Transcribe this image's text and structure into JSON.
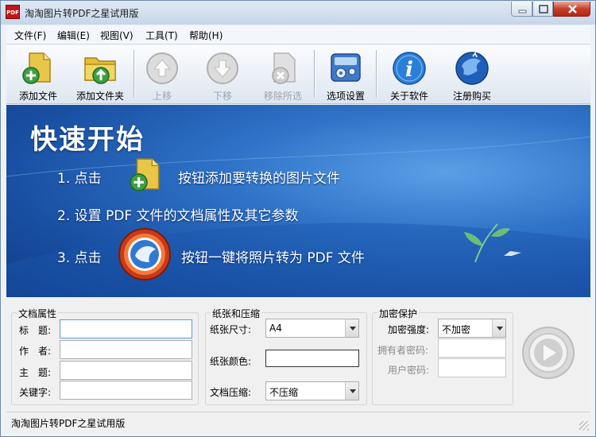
{
  "window": {
    "title": "淘淘图片转PDF之星试用版",
    "icon_text": "PDF"
  },
  "menu": [
    {
      "label": "文件(F)"
    },
    {
      "label": "编辑(E)"
    },
    {
      "label": "视图(V)"
    },
    {
      "label": "工具(T)"
    },
    {
      "label": "帮助(H)"
    }
  ],
  "toolbar": {
    "add_file": "添加文件",
    "add_folder": "添加文件夹",
    "move_up": "上移",
    "move_down": "下移",
    "remove_selected": "移除所选",
    "options": "选项设置",
    "about": "关于软件",
    "register": "注册购买"
  },
  "banner": {
    "title": "快速开始",
    "step1_num": "1. 点击",
    "step1_text": "按钮添加要转换的图片文件",
    "step2_text": "2. 设置 PDF 文件的文档属性及其它参数",
    "step3_num": "3. 点击",
    "step3_text": "按钮一键将照片转为 PDF 文件"
  },
  "doc_props": {
    "group_title": "文档属性",
    "title_label": "标　题:",
    "author_label": "作　者:",
    "subject_label": "主　题:",
    "keywords_label": "关键字:",
    "title_value": "",
    "author_value": "",
    "subject_value": "",
    "keywords_value": ""
  },
  "paper": {
    "group_title": "纸张和压缩",
    "size_label": "纸张尺寸:",
    "size_value": "A4",
    "color_label": "纸张颜色:",
    "color_value": "#ffffff",
    "compress_label": "文档压缩:",
    "compress_value": "不压缩"
  },
  "encrypt": {
    "group_title": "加密保护",
    "strength_label": "加密强度:",
    "strength_value": "不加密",
    "owner_pw_label": "拥有者密码:",
    "user_pw_label": "用户密码:",
    "owner_pw_value": "",
    "user_pw_value": ""
  },
  "status": {
    "text": "淘淘图片转PDF之星试用版"
  },
  "colors": {
    "accent": "#1d5bb0",
    "close_red": "#c7402b",
    "banner_dark": "#0f3b84",
    "banner_light": "#5aa0e6"
  }
}
